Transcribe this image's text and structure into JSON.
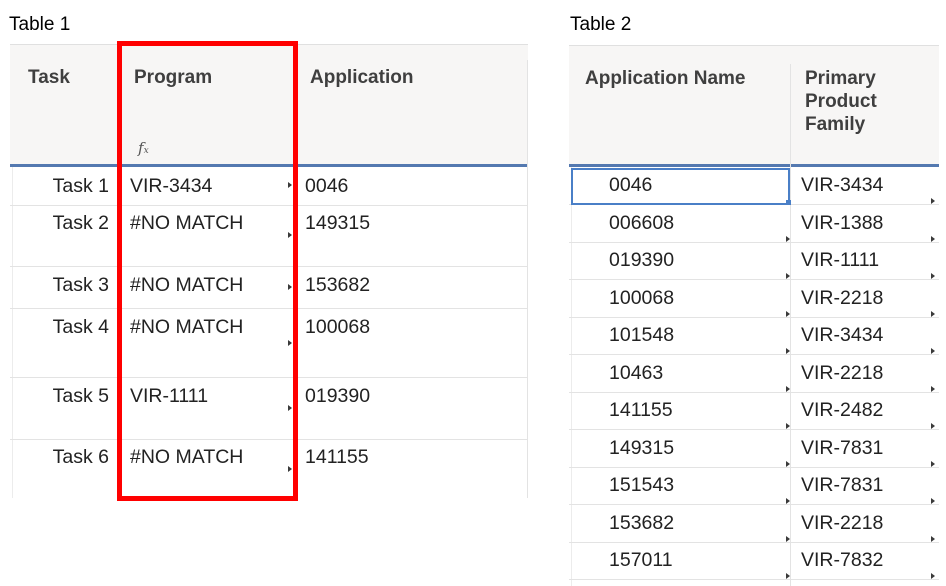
{
  "table1": {
    "caption": "Table 1",
    "columns": [
      "Task",
      "Program",
      "Application"
    ],
    "formula_icon": "function-fx-icon",
    "rows": [
      {
        "task": "Task 1",
        "program": "VIR-3434",
        "application": "0046"
      },
      {
        "task": "Task 2",
        "program": "#NO MATCH",
        "application": "149315"
      },
      {
        "task": "Task 3",
        "program": "#NO MATCH",
        "application": "153682"
      },
      {
        "task": "Task 4",
        "program": "#NO MATCH",
        "application": "100068"
      },
      {
        "task": "Task 5",
        "program": "VIR-1111",
        "application": "019390"
      },
      {
        "task": "Task 6",
        "program": "#NO MATCH",
        "application": "141155"
      }
    ],
    "highlight_color": "#ff0000"
  },
  "table2": {
    "caption": "Table 2",
    "columns": [
      "Application Name",
      "Primary Product Family"
    ],
    "rows": [
      {
        "app": "0046",
        "family": "VIR-3434"
      },
      {
        "app": "006608",
        "family": "VIR-1388"
      },
      {
        "app": "019390",
        "family": "VIR-1111"
      },
      {
        "app": "100068",
        "family": "VIR-2218"
      },
      {
        "app": "101548",
        "family": "VIR-3434"
      },
      {
        "app": "10463",
        "family": "VIR-2218"
      },
      {
        "app": "141155",
        "family": "VIR-2482"
      },
      {
        "app": "149315",
        "family": "VIR-7831"
      },
      {
        "app": "151543",
        "family": "VIR-7831"
      },
      {
        "app": "153682",
        "family": "VIR-2218"
      },
      {
        "app": "157011",
        "family": "VIR-7832"
      }
    ],
    "selection_color": "#4a7fc7"
  },
  "header_rule_color": "#5479b0"
}
